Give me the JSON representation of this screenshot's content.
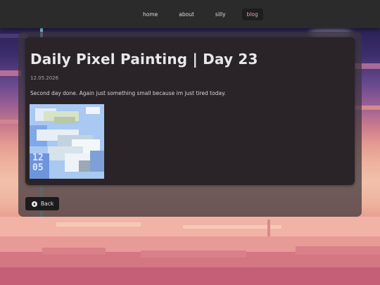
{
  "nav": {
    "items": [
      {
        "label": "home"
      },
      {
        "label": "about"
      },
      {
        "label": "silly"
      },
      {
        "label": "blog"
      }
    ],
    "active": "blog",
    "active_color": "#e7a2b4"
  },
  "post": {
    "title": "Daily Pixel Painting | Day 23",
    "date": "12.05.2026",
    "body": "Second day done. Again just something small because im just tired today.",
    "image_text": "12 05"
  },
  "back_button": {
    "label": "Back",
    "icon": "arrow-left-circle-icon"
  },
  "colors": {
    "navbar": "#2b2b2b",
    "card": "#2a2428",
    "sky_top": "#2b2356",
    "sky_mid": "#eeb19d",
    "ground": "#c9647a"
  }
}
